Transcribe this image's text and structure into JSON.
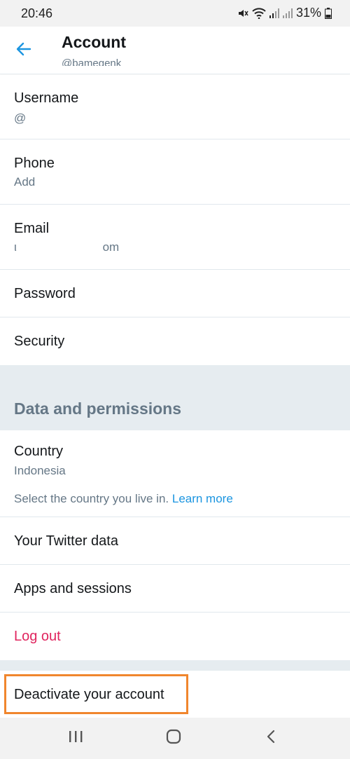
{
  "status_bar": {
    "time": "20:46",
    "battery": "31%",
    "icons": [
      "mute-icon",
      "wifi-icon",
      "signal-icon",
      "signal-icon",
      "battery-icon"
    ]
  },
  "header": {
    "title": "Account",
    "handle": "@bamegenk",
    "back_icon": "arrow-left-icon"
  },
  "account_items": [
    {
      "label": "Username",
      "value": "@"
    },
    {
      "label": "Phone",
      "value": "Add"
    },
    {
      "label": "Email",
      "value": "ι                          om"
    },
    {
      "label": "Password"
    },
    {
      "label": "Security"
    }
  ],
  "data_section": {
    "title": "Data and permissions",
    "country": {
      "label": "Country",
      "value": "Indonesia",
      "help": "Select the country you live in.",
      "help_link": "Learn more"
    },
    "items": [
      {
        "label": "Your Twitter data"
      },
      {
        "label": "Apps and sessions"
      },
      {
        "label": "Log out"
      }
    ]
  },
  "deactivate": {
    "label": "Deactivate your account"
  },
  "nav_bar": {
    "icons": [
      "recent-apps-icon",
      "home-icon",
      "back-icon"
    ]
  },
  "colors": {
    "accent": "#1b95e0",
    "logout": "#e0245e",
    "highlight": "#f0862d",
    "section_bg": "#e6ecf0"
  }
}
